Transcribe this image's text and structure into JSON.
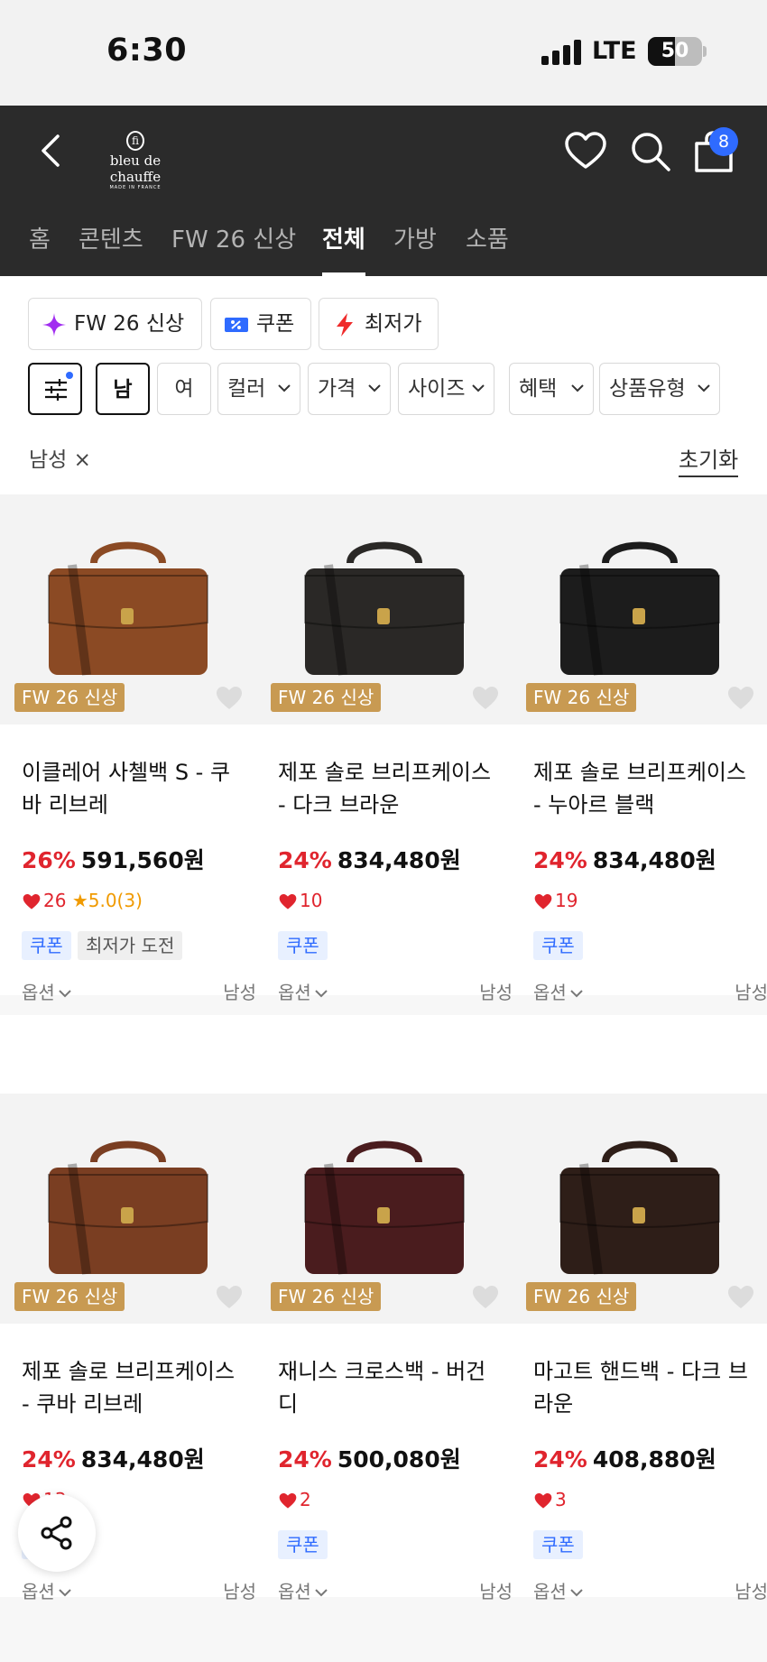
{
  "status_bar": {
    "time": "6:30",
    "network": "LTE",
    "battery": "50"
  },
  "header": {
    "logo_mark": "fi",
    "logo_name": "bleu de chauffe",
    "logo_sub": "MADE IN FRANCE",
    "cart_count": "8"
  },
  "tabs": [
    {
      "label": "홈"
    },
    {
      "label": "콘텐츠"
    },
    {
      "label": "FW 26 신상"
    },
    {
      "label": "전체",
      "active": true
    },
    {
      "label": "가방"
    },
    {
      "label": "소품"
    }
  ],
  "quick_chips": [
    {
      "label": "FW 26 신상",
      "icon": "sparkle-icon"
    },
    {
      "label": "쿠폰",
      "icon": "coupon-icon"
    },
    {
      "label": "최저가",
      "icon": "lightning-icon"
    }
  ],
  "filters": {
    "gender_male": "남",
    "gender_female": "여",
    "dropdowns": [
      "컬러",
      "가격",
      "사이즈",
      "혜택",
      "상품유형"
    ]
  },
  "applied_filter": "남성 ×",
  "reset_label": "초기화",
  "colors": {
    "discount": "#e0252e",
    "coupon": "#2f6bff",
    "badge": "#c89a52",
    "header": "#2b2b2b"
  },
  "products": [
    {
      "badge": "FW 26 신상",
      "name": "이클레어 사첼백 S - 쿠바 리브레",
      "discount": "26%",
      "price": "591,560원",
      "likes": "26",
      "rating": "5.0(3)",
      "tags": [
        "쿠폰",
        "최저가 도전"
      ],
      "option": "옵션",
      "gender": "남성",
      "color": "#8b4a24"
    },
    {
      "badge": "FW 26 신상",
      "name": "제포 솔로 브리프케이스 - 다크 브라운",
      "discount": "24%",
      "price": "834,480원",
      "likes": "10",
      "rating": "",
      "tags": [
        "쿠폰"
      ],
      "option": "옵션",
      "gender": "남성",
      "color": "#2a2826"
    },
    {
      "badge": "FW 26 신상",
      "name": "제포 솔로 브리프케이스 - 누아르 블랙",
      "discount": "24%",
      "price": "834,480원",
      "likes": "19",
      "rating": "",
      "tags": [
        "쿠폰"
      ],
      "option": "옵션",
      "gender": "남성",
      "color": "#1c1c1c"
    },
    {
      "badge": "FW 26 신상",
      "name": "제포 솔로 브리프케이스 - 쿠바 리브레",
      "discount": "24%",
      "price": "834,480원",
      "likes": "13",
      "rating": "",
      "tags": [
        "쿠폰"
      ],
      "option": "옵션",
      "gender": "남성",
      "color": "#7a3e22"
    },
    {
      "badge": "FW 26 신상",
      "name": "재니스 크로스백 - 버건디",
      "discount": "24%",
      "price": "500,080원",
      "likes": "2",
      "rating": "",
      "tags": [
        "쿠폰"
      ],
      "option": "옵션",
      "gender": "남성",
      "color": "#4a1c1e"
    },
    {
      "badge": "FW 26 신상",
      "name": "마고트 핸드백 - 다크 브라운",
      "discount": "24%",
      "price": "408,880원",
      "likes": "3",
      "rating": "",
      "tags": [
        "쿠폰"
      ],
      "option": "옵션",
      "gender": "남성",
      "color": "#2e1e18"
    }
  ]
}
